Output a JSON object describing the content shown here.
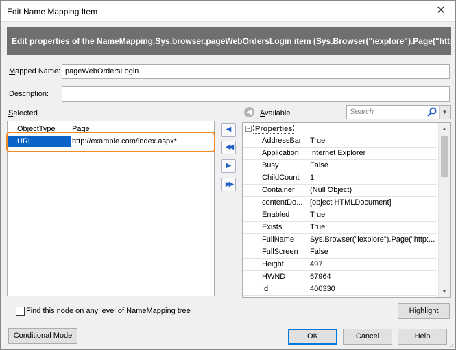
{
  "window": {
    "title": "Edit Name Mapping Item",
    "close_glyph": "✕"
  },
  "banner": {
    "text": "Edit properties of the NameMapping.Sys.browser.pageWebOrdersLogin item (Sys.Browser(\"iexplore\").Page(\"http"
  },
  "form": {
    "mapped_name_label_pre": "",
    "mapped_name_label_u": "M",
    "mapped_name_label_post": "apped Name:",
    "mapped_name_value": "pageWebOrdersLogin",
    "description_label_u": "D",
    "description_label_post": "escription:",
    "description_value": ""
  },
  "selected": {
    "label_u": "S",
    "label_post": "elected",
    "rows": [
      {
        "name": "ObjectType",
        "value": "Page"
      },
      {
        "name": "URL",
        "value": "http://example.com/index.aspx*"
      }
    ],
    "selected_index": 1
  },
  "move_buttons": {
    "icons": [
      "arrow-left-icon",
      "double-arrow-left-icon",
      "arrow-right-icon",
      "double-arrow-right-icon"
    ],
    "glyphs": [
      "◀",
      "◀◀",
      "▶",
      "▶▶"
    ]
  },
  "available": {
    "label_u": "A",
    "label_post": "vailable",
    "search_placeholder": "Search",
    "group_label": "Properties",
    "rows": [
      {
        "name": "AddressBar",
        "value": "True"
      },
      {
        "name": "Application",
        "value": "Internet Explorer"
      },
      {
        "name": "Busy",
        "value": "False"
      },
      {
        "name": "ChildCount",
        "value": "1"
      },
      {
        "name": "Container",
        "value": "(Null Object)"
      },
      {
        "name": "contentDo...",
        "value": "[object HTMLDocument]"
      },
      {
        "name": "Enabled",
        "value": "True"
      },
      {
        "name": "Exists",
        "value": "True"
      },
      {
        "name": "FullName",
        "value": "Sys.Browser(\"iexplore\").Page(\"http:..."
      },
      {
        "name": "FullScreen",
        "value": "False"
      },
      {
        "name": "Height",
        "value": "497"
      },
      {
        "name": "HWND",
        "value": "67964"
      },
      {
        "name": "Id",
        "value": "400330"
      }
    ]
  },
  "footer": {
    "find_node_label": "Find this node on any level of NameMapping tree",
    "find_node_checked": false,
    "highlight_label": "Highlight",
    "conditional_mode_label": "Conditional Mode",
    "ok_label": "OK",
    "cancel_label": "Cancel",
    "help_label": "Help"
  },
  "colors": {
    "accent_selection": "#0a64c8",
    "highlight_border": "#f08a24",
    "banner_bg": "#6f6f6f"
  }
}
